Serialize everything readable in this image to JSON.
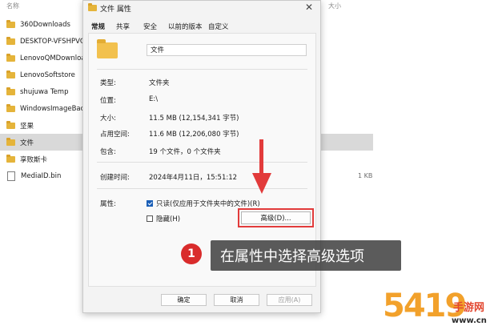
{
  "explorer": {
    "col_name": "名称",
    "col_size": "大小",
    "close_glyph": "✕",
    "files": [
      {
        "name": "360Downloads",
        "type": "folder",
        "size": ""
      },
      {
        "name": "DESKTOP-VFSHPVC",
        "type": "folder",
        "size": ""
      },
      {
        "name": "LenovoQMDownload",
        "type": "folder",
        "size": ""
      },
      {
        "name": "LenovoSoftstore",
        "type": "folder",
        "size": ""
      },
      {
        "name": "shujuwa Temp",
        "type": "folder",
        "size": ""
      },
      {
        "name": "WindowsImageBackup",
        "type": "folder",
        "size": ""
      },
      {
        "name": "坚果",
        "type": "folder",
        "size": ""
      },
      {
        "name": "文件",
        "type": "folder",
        "size": "",
        "selected": true
      },
      {
        "name": "享败斯卡",
        "type": "folder",
        "size": ""
      },
      {
        "name": "MediaID.bin",
        "type": "file",
        "size": "1 KB"
      }
    ]
  },
  "dialog": {
    "title": "文件 属性",
    "close_glyph": "✕",
    "tabs": [
      "常规",
      "共享",
      "安全",
      "以前的版本",
      "自定义"
    ],
    "active_tab": 0,
    "folder_name": "文件",
    "props": [
      {
        "label": "类型:",
        "value": "文件夹"
      },
      {
        "label": "位置:",
        "value": "E:\\"
      },
      {
        "label": "大小:",
        "value": "11.5 MB (12,154,341 字节)"
      },
      {
        "label": "占用空间:",
        "value": "11.6 MB (12,206,080 字节)"
      },
      {
        "label": "包含:",
        "value": "19 个文件，0 个文件夹"
      },
      {
        "label": "创建时间:",
        "value": "2024年4月11日，15:51:12"
      }
    ],
    "attributes_label": "属性:",
    "readonly_label": "只读(仅应用于文件夹中的文件)(R)",
    "readonly_checked": true,
    "hidden_label": "隐藏(H)",
    "hidden_checked": false,
    "advanced_button": "高级(D)...",
    "ok_button": "确定",
    "cancel_button": "取消",
    "apply_button": "应用(A)"
  },
  "annotation": {
    "step_number": "1",
    "text": "在属性中选择高级选项",
    "highlight_color": "#e23b3b"
  },
  "watermark": {
    "number": "5419",
    "site_cn": "手游网",
    "url": "www.cn"
  }
}
